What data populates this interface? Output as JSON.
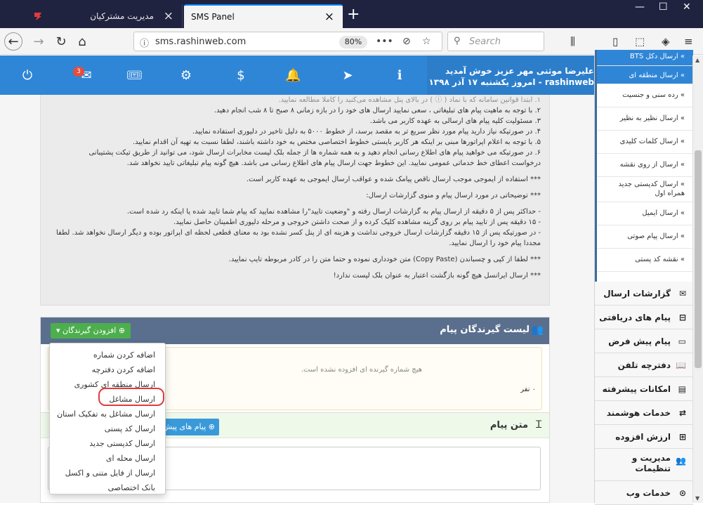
{
  "browser": {
    "tabs": [
      {
        "label": "مدیریت مشترکیان"
      },
      {
        "label": "SMS Panel"
      }
    ],
    "url": "sms.rashinweb.com",
    "zoom": "80%",
    "search_placeholder": "Search"
  },
  "header": {
    "badge": "3",
    "welcome_line1": "علیرضا موثنی مهر عزیز خوش آمدید",
    "welcome_line2": "rashinweb - امروز یکشنبه ۱۷ آذر ۱۳۹۸"
  },
  "rules": {
    "lines": [
      "۱. ابتدا قوانین سامانه که با نماد ( ⓘ ) در بالای پنل مشاهده می‌کنید را کاملا مطالعه نمایید.",
      "۲. با توجه به ماهیت پیام های تبلیغاتی ، سعی نمایید ارسال های خود را در بازه زمانی ۸ صبح تا ۸ شب انجام دهید.",
      "۳. مسئولیت کلیه پیام های ارسالی به عهده کاربر می باشد.",
      "۴. در صورتیکه نیاز دارید پیام مورد نظر سریع تر به مقصد برسد، از خطوط ۵۰۰۰ به دلیل تاخیر در دلیوری استفاده نمایید.",
      "۵. با توجه به اعلام اپراتورها مبنی بر اینکه هر کاربر بایستی خطوط اختصاصی مختص به خود داشته باشند، لطفا نسبت به تهیه آن اقدام نمایید.",
      "۶. در صورتیکه می خواهید پیام های اطلاع رسانی انجام دهید و به همه شماره ها از جمله بلک لیست مخابرات ارسال شود، می توانید از طریق تیکت پشتیبانی",
      "درخواست اعطای خط خدماتی عمومی نمایید. این خطوط جهت ارسال پیام های اطلاع رسانی می باشد. هیچ گونه پیام تبلیغاتی تایید نخواهد شد."
    ],
    "emoji_note": "*** استفاده از ایموجی موجب ارسال ناقص پیامک شده و عواقب ارسال ایموجی به عهده کاربر است.",
    "report_title": "*** توضیحاتی در مورد ارسال پیام و منوی گزارشات ارسال:",
    "report_lines": [
      "- حداکثر پس از ۵ دقیقه از ارسال پیام به گزارشات ارسال رفته و \"وضعیت تایید\"را مشاهده نمایید که پیام شما تایید شده یا اینکه رد شده است.",
      "- ۱۵ دقیقه پس از تایید پیام بر روی گزینه مشاهده کلیک کرده و از صحت داشتن خروجی و مرحله دلیوری اطمینان حاصل نمایید.",
      "- در صورتیکه پس از ۱۵ دقیقه گزارشات ارسال خروجی نداشت و هزینه ای از پنل کسر نشده بود به معنای قطعی لحظه ای اپراتور بوده و دیگر ارسال نخواهد شد. لطفا",
      "مجددا پیام خود را ارسال نمایید."
    ],
    "copy_note": "*** لطفا از کپی و چسباندن (Copy Paste) متن خودداری نموده و حتما متن را در کادر مربوطه تایپ نمایید.",
    "intl_note": "*** ارسال ایرانسل هیچ گونه بازگشت اعتبار به عنوان بلک لیست ندارد!"
  },
  "recipients": {
    "title": "لیست گیرندگان پیام",
    "add_button": "افزودن گیرندگان",
    "empty_text": "هیچ شماره گیرنده ای افزوده نشده است.",
    "count": "۰ نفر"
  },
  "dropdown": {
    "items": [
      "اضافه کردن شماره",
      "اضافه کردن دفترچه",
      "ارسال منطقه ای کشوری",
      "ارسال مشاغل",
      "ارسال مشاغل به تفکیک استان",
      "ارسال کد پستی",
      "ارسال کدپستی جدید",
      "ارسال محله ای",
      "ارسال از فایل متنی و اکسل",
      "بانک اختصاصی"
    ]
  },
  "message": {
    "title": "متن پیام",
    "button": "پیام های پیش فرض"
  },
  "sidebar": {
    "sub_items": [
      {
        "label": "» ارسال دکل BTS"
      },
      {
        "label": "» ارسال منطقه ای"
      },
      {
        "label": "» رده سنی و جنسیت"
      },
      {
        "label": "» ارسال نظیر به نظیر"
      },
      {
        "label": "» ارسال کلمات کلیدی"
      },
      {
        "label": "» ارسال از روی نقشه"
      },
      {
        "label": "» ارسال کدپستی جدید همراه اول"
      },
      {
        "label": "» ارسال ایمیل"
      },
      {
        "label": "» ارسال پیام صوتی"
      },
      {
        "label": "» نقشه کد پستی"
      }
    ],
    "main_items": [
      {
        "label": "گزارشات ارسال",
        "icon": "envelope-icon"
      },
      {
        "label": "پیام های دریافتی",
        "icon": "inbox-icon"
      },
      {
        "label": "پیام پیش فرض",
        "icon": "file-icon"
      },
      {
        "label": "دفترچه تلفن",
        "icon": "book-icon"
      },
      {
        "label": "امکانات پیشرفته",
        "icon": "id-card-icon"
      },
      {
        "label": "خدمات هوشمند",
        "icon": "retweet-icon"
      },
      {
        "label": "ارزش افزوده",
        "icon": "plus-square-icon"
      },
      {
        "label": "مدیریت و تنظیمات",
        "icon": "users-icon"
      },
      {
        "label": "خدمات وب",
        "icon": "chevron-circle-icon"
      }
    ]
  }
}
